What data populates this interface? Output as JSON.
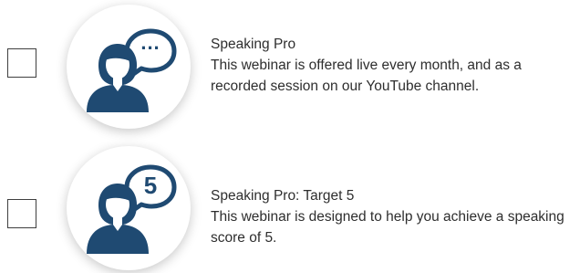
{
  "options": [
    {
      "title": "Speaking Pro",
      "description": "This webinar is offered live every month, and as a recorded session on our YouTube channel.",
      "bubble_text": "..."
    },
    {
      "title": "Speaking Pro: Target 5",
      "description": "This webinar is designed to help you achieve a speaking score of 5.",
      "bubble_text": "5"
    }
  ],
  "icons": {
    "option_1": "speaker-with-speech-bubble-icon",
    "option_2": "speaker-with-speech-bubble-5-icon"
  },
  "colors": {
    "icon": "#1f4a72",
    "text": "#2e2e2e",
    "checkbox_border": "#3f3f3f"
  }
}
